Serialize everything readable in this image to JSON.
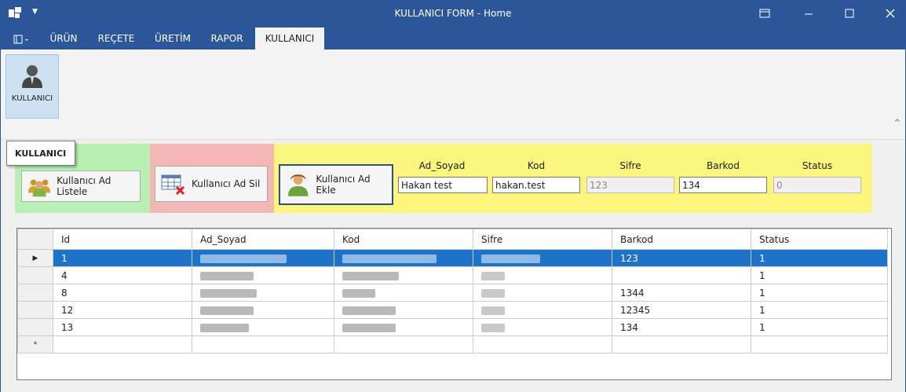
{
  "window": {
    "title": "KULLANICI FORM - Home"
  },
  "tabs": [
    "ÜRÜN",
    "REÇETE",
    "ÜRETİM",
    "RAPOR",
    "KULLANICI"
  ],
  "ribbon": {
    "button_label": "KULLANICI",
    "tooltip": "KULLANICI"
  },
  "actions": {
    "list_label": "Kullanıcı Ad Listele",
    "delete_label": "Kullanıcı Ad Sil",
    "add_label": "Kullanıcı Ad Ekle"
  },
  "fields": {
    "labels": [
      "Ad_Soyad",
      "Kod",
      "Sifre",
      "Barkod",
      "Status"
    ],
    "ad_soyad": "Hakan test",
    "kod": "hakan.test",
    "sifre": "123",
    "barkod": "134",
    "status": "0"
  },
  "grid": {
    "columns": [
      "Id",
      "Ad_Soyad",
      "Kod",
      "Sifre",
      "Barkod",
      "Status"
    ],
    "rows": [
      {
        "id": "1",
        "barkod": "123",
        "status": "1"
      },
      {
        "id": "4",
        "barkod": "",
        "status": "1"
      },
      {
        "id": "8",
        "barkod": "1344",
        "status": "1"
      },
      {
        "id": "12",
        "barkod": "12345",
        "status": "1"
      },
      {
        "id": "13",
        "barkod": "134",
        "status": "1"
      }
    ],
    "new_row_marker": "*"
  },
  "colors": {
    "title_bar": "#2b579a",
    "green_panel": "#b7f0b2",
    "red_panel": "#f5b6b6",
    "yellow_panel": "#fbf47d",
    "selected_row": "#1e73c8"
  }
}
